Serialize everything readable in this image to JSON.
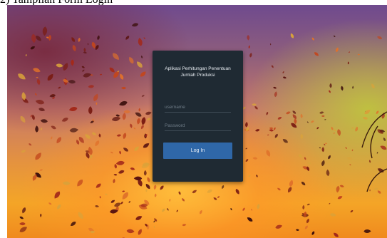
{
  "caption": "2) Tampilan Form Login",
  "login": {
    "title": "Aplikasi Perhitungan Penentuan\nJumlah Produksi",
    "username_placeholder": "username",
    "password_placeholder": "Password",
    "button_label": "Log In"
  },
  "colors": {
    "dialog_bg": "#1f2a33",
    "button_bg": "#2f67a8"
  }
}
